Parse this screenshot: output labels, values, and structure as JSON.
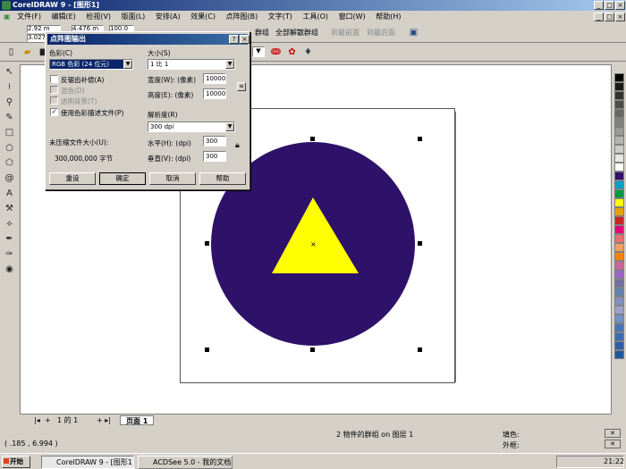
{
  "app_title": "CorelDRAW 9 - [图形1]",
  "menu": [
    "文件(F)",
    "编辑(E)",
    "检视(V)",
    "版面(L)",
    "安排(A)",
    "效果(C)",
    "点阵图(B)",
    "文字(T)",
    "工具(O)",
    "窗口(W)",
    "帮助(H)"
  ],
  "toolbar": {
    "x_pos": "2.92 m",
    "y_pos": "3.027",
    "width": "4.476 m",
    "scale": "100.0 %",
    "group_label": "群组",
    "ungroup_all_label": "全部解散群组",
    "to_front_label": "到最前面",
    "to_back_label": "到最后面"
  },
  "dialog": {
    "title": "点阵图输出",
    "color_label": "色彩(C)",
    "color_value": "RGB 色彩 (24 位元)",
    "size_label": "大小(S)",
    "size_value": "1 比 1",
    "antialias_label": "反锯齿补偿(A)",
    "dither_label": "混色(D)",
    "transparent_label": "透明背景(T)",
    "use_profile_label": "使用色彩描述文件(P)",
    "width_label": "宽度(W): (像素)",
    "width_value": "10000",
    "height_label": "高度(E): (像素)",
    "height_value": "10000",
    "resolution_label": "解析度(R)",
    "resolution_value": "300 dpi",
    "uncompressed_label": "未压缩文件大小(U):",
    "uncompressed_value": "300,000,000 字节",
    "horizontal_label": "水平(H): (dpi)",
    "horizontal_value": "300",
    "vertical_label": "垂直(V): (dpi)",
    "vertical_value": "300",
    "reset_label": "重设",
    "ok_label": "确定",
    "cancel_label": "取消",
    "help_label": "帮助"
  },
  "page_tabs": {
    "counter": "1 的 1",
    "page_label": "页面 1"
  },
  "status": {
    "coords": "( .185 , 6.994 )",
    "selection": "2 物件的群组 on 图层 1",
    "fill_label": "填色:",
    "outline_label": "外框:"
  },
  "taskbar": {
    "start_label": "开始",
    "task1": "CorelDRAW 9 - [图形1]",
    "task2": "ACDSee 5.0 - 我的文档",
    "clock": "21:22"
  },
  "colors": {
    "circle": "#2e1169",
    "triangle": "#ffff00",
    "palette": [
      "#000000",
      "#1a1a1a",
      "#333333",
      "#4d4d4d",
      "#666666",
      "#808080",
      "#999999",
      "#b3b3b3",
      "#cccccc",
      "#e6e6e6",
      "#ffffff",
      "#2e1169",
      "#00a0c8",
      "#009944",
      "#ffff00",
      "#e8a000",
      "#cc2222",
      "#e60073",
      "#e87070",
      "#f0a060",
      "#ff8000",
      "#cc6699",
      "#9966cc",
      "#7070a0",
      "#6080b0",
      "#8090c0",
      "#9aa0cc",
      "#7090c8",
      "#4a74b8",
      "#3a6cb0",
      "#2a60a8",
      "#1f58a0"
    ]
  }
}
